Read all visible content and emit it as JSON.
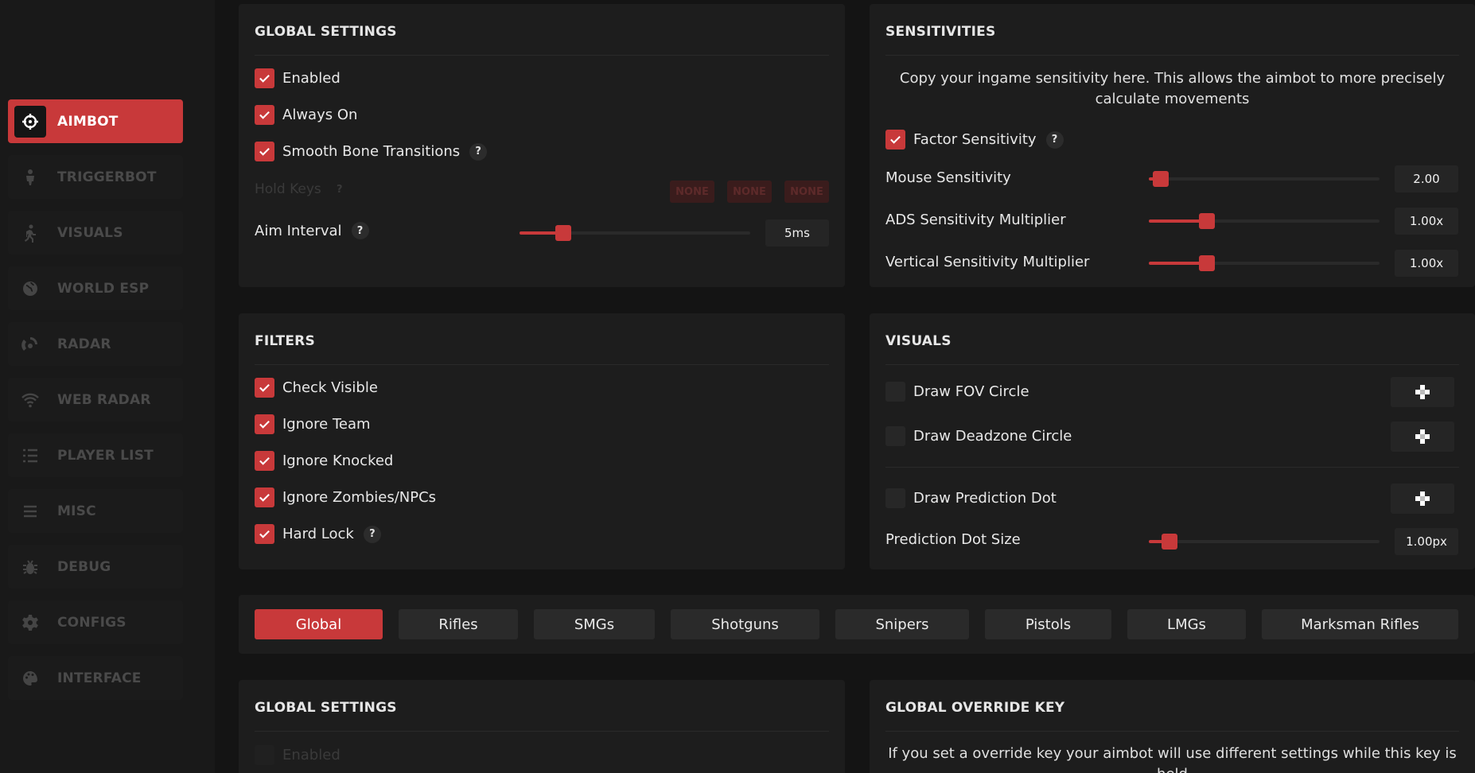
{
  "sidebar": {
    "items": [
      {
        "label": "AIMBOT",
        "icon": "crosshair-icon",
        "active": true
      },
      {
        "label": "TRIGGERBOT",
        "icon": "person-aim-icon"
      },
      {
        "label": "VISUALS",
        "icon": "person-walk-icon"
      },
      {
        "label": "WORLD ESP",
        "icon": "globe-icon"
      },
      {
        "label": "RADAR",
        "icon": "radar-icon"
      },
      {
        "label": "WEB RADAR",
        "icon": "wifi-icon"
      },
      {
        "label": "PLAYER LIST",
        "icon": "list-icon"
      },
      {
        "label": "MISC",
        "icon": "menu-icon"
      },
      {
        "label": "DEBUG",
        "icon": "bug-icon"
      },
      {
        "label": "CONFIGS",
        "icon": "gear-icon"
      },
      {
        "label": "INTERFACE",
        "icon": "palette-icon"
      }
    ]
  },
  "global_settings": {
    "title": "GLOBAL SETTINGS",
    "enabled": {
      "label": "Enabled",
      "checked": true
    },
    "always_on": {
      "label": "Always On",
      "checked": true
    },
    "smooth_bone": {
      "label": "Smooth Bone Transitions",
      "checked": true,
      "help": "?"
    },
    "hold_keys": {
      "label": "Hold Keys",
      "help": "?",
      "keys": [
        "NONE",
        "NONE",
        "NONE"
      ]
    },
    "aim_interval": {
      "label": "Aim Interval",
      "help": "?",
      "value": "5ms",
      "fraction": 0.19
    }
  },
  "sensitivities": {
    "title": "SENSITIVITIES",
    "description": "Copy your ingame sensitivity here. This allows the aimbot to more precisely calculate movements",
    "factor": {
      "label": "Factor Sensitivity",
      "checked": true,
      "help": "?"
    },
    "mouse": {
      "label": "Mouse Sensitivity",
      "value": "2.00",
      "fraction": 0.05
    },
    "ads": {
      "label": "ADS Sensitivity Multiplier",
      "value": "1.00x",
      "fraction": 0.25
    },
    "vertical": {
      "label": "Vertical Sensitivity Multiplier",
      "value": "1.00x",
      "fraction": 0.25
    }
  },
  "filters": {
    "title": "FILTERS",
    "items": [
      {
        "label": "Check Visible",
        "checked": true
      },
      {
        "label": "Ignore Team",
        "checked": true
      },
      {
        "label": "Ignore Knocked",
        "checked": true
      },
      {
        "label": "Ignore Zombies/NPCs",
        "checked": true
      },
      {
        "label": "Hard Lock",
        "checked": true,
        "help": "?"
      }
    ]
  },
  "visuals": {
    "title": "VISUALS",
    "fov": {
      "label": "Draw FOV Circle",
      "checked": false
    },
    "deadzone": {
      "label": "Draw Deadzone Circle",
      "checked": false
    },
    "prediction": {
      "label": "Draw Prediction Dot",
      "checked": false
    },
    "dot_size": {
      "label": "Prediction Dot Size",
      "value": "1.00px",
      "fraction": 0.09
    }
  },
  "weapon_tabs": [
    "Global",
    "Rifles",
    "SMGs",
    "Shotguns",
    "Snipers",
    "Pistols",
    "LMGs",
    "Marksman Rifles"
  ],
  "global_settings_2": {
    "title": "GLOBAL SETTINGS",
    "enabled": {
      "label": "Enabled",
      "checked": false
    }
  },
  "override": {
    "title": "GLOBAL OVERRIDE KEY",
    "description": "If you set a override key your aimbot will use different settings while this key is held"
  },
  "colors": {
    "accent": "#c8393a",
    "panel": "#1d1d1d",
    "background": "#141414"
  }
}
